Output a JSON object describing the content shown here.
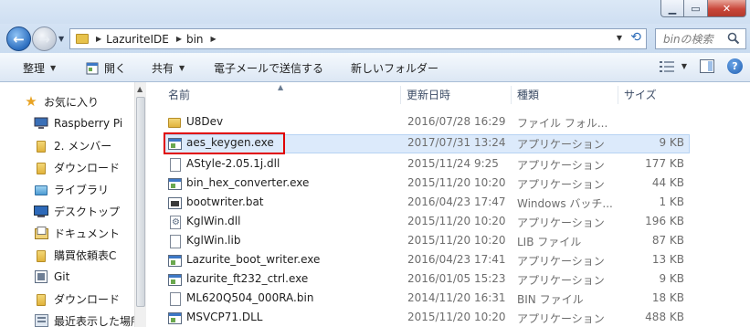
{
  "address": {
    "crumbs": [
      "LazuriteIDE",
      "bin"
    ],
    "search_placeholder": "binの検索"
  },
  "toolbar": {
    "organize": "整理",
    "open": "開く",
    "share": "共有",
    "email": "電子メールで送信する",
    "new_folder": "新しいフォルダー"
  },
  "nav": {
    "items": [
      {
        "label": "お気に入り",
        "icon": "star-icon"
      },
      {
        "label": "Raspberry Pi",
        "icon": "computer-icon"
      },
      {
        "label": "2. メンバー",
        "icon": "folder-icon"
      },
      {
        "label": "ダウンロード",
        "icon": "download-folder-icon"
      },
      {
        "label": "ライブラリ",
        "icon": "library-icon"
      },
      {
        "label": "デスクトップ",
        "icon": "desktop-icon"
      },
      {
        "label": "ドキュメント",
        "icon": "documents-icon"
      },
      {
        "label": "購買依頼表C",
        "icon": "folder-icon"
      },
      {
        "label": "Git",
        "icon": "git-icon"
      },
      {
        "label": "ダウンロード",
        "icon": "download-folder-icon"
      },
      {
        "label": "最近表示した場所",
        "icon": "recent-places-icon"
      }
    ]
  },
  "columns": {
    "name": "名前",
    "date": "更新日時",
    "type": "種類",
    "size": "サイズ"
  },
  "files": [
    {
      "name": "U8Dev",
      "date": "2016/07/28 16:29",
      "type": "ファイル フォル...",
      "size": "",
      "icon": "folder-icon"
    },
    {
      "name": "aes_keygen.exe",
      "date": "2017/07/31 13:24",
      "type": "アプリケーション",
      "size": "9 KB",
      "icon": "exe-icon",
      "selected": true
    },
    {
      "name": "AStyle-2.05.1j.dll",
      "date": "2015/11/24 9:25",
      "type": "アプリケーション",
      "size": "177 KB",
      "icon": "doc-icon"
    },
    {
      "name": "bin_hex_converter.exe",
      "date": "2015/11/20 10:20",
      "type": "アプリケーション",
      "size": "44 KB",
      "icon": "exe-icon"
    },
    {
      "name": "bootwriter.bat",
      "date": "2016/04/23 17:47",
      "type": "Windows バッチ...",
      "size": "1 KB",
      "icon": "bat-icon"
    },
    {
      "name": "KglWin.dll",
      "date": "2015/11/20 10:20",
      "type": "アプリケーション",
      "size": "196 KB",
      "icon": "dll-icon"
    },
    {
      "name": "KglWin.lib",
      "date": "2015/11/20 10:20",
      "type": "LIB ファイル",
      "size": "87 KB",
      "icon": "doc-icon"
    },
    {
      "name": "Lazurite_boot_writer.exe",
      "date": "2016/04/23 17:41",
      "type": "アプリケーション",
      "size": "13 KB",
      "icon": "exe-icon"
    },
    {
      "name": "lazurite_ft232_ctrl.exe",
      "date": "2016/01/05 15:23",
      "type": "アプリケーション",
      "size": "9 KB",
      "icon": "exe-icon"
    },
    {
      "name": "ML620Q504_000RA.bin",
      "date": "2014/11/20 16:31",
      "type": "BIN ファイル",
      "size": "18 KB",
      "icon": "doc-icon"
    },
    {
      "name": "MSVCP71.DLL",
      "date": "2015/11/20 10:20",
      "type": "アプリケーション",
      "size": "488 KB",
      "icon": "dll-icon"
    }
  ]
}
